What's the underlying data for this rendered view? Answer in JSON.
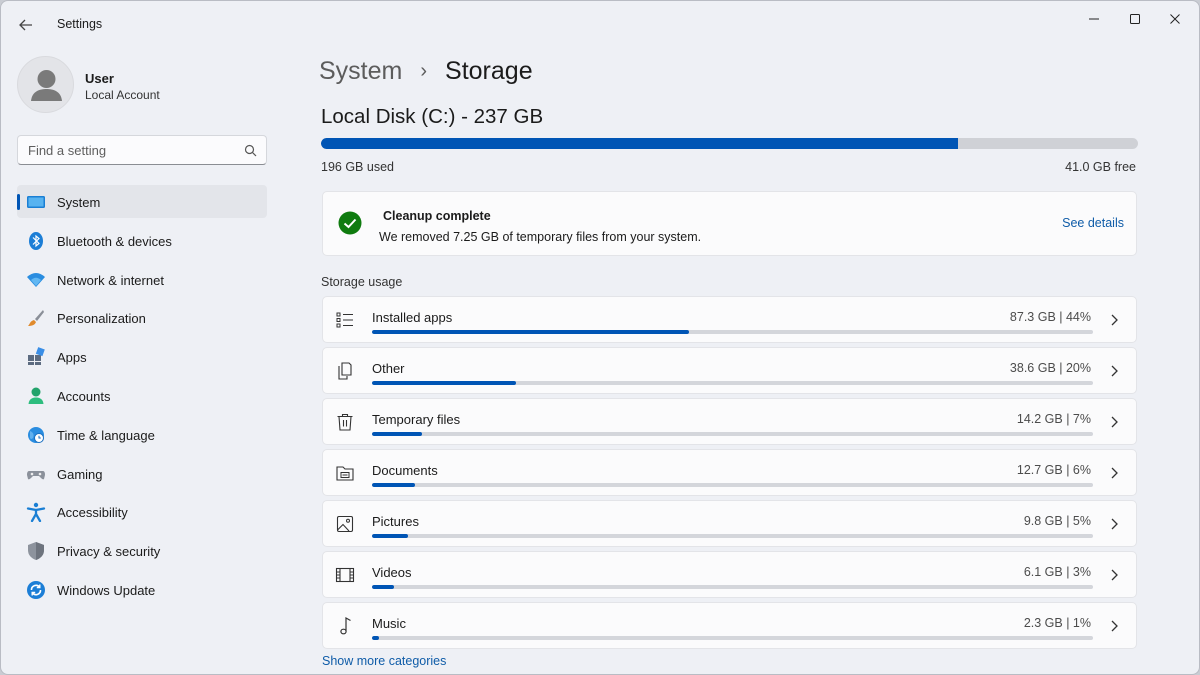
{
  "window": {
    "title": "Settings",
    "controls": [
      "minimize-icon",
      "maximize-icon",
      "close-icon"
    ]
  },
  "user": {
    "name": "User",
    "account_type": "Local Account"
  },
  "search": {
    "placeholder": "Find a setting"
  },
  "sidebar": {
    "items": [
      {
        "label": "System",
        "icon": "system-icon",
        "active": true
      },
      {
        "label": "Bluetooth & devices",
        "icon": "bluetooth-icon"
      },
      {
        "label": "Network & internet",
        "icon": "wifi-icon"
      },
      {
        "label": "Personalization",
        "icon": "brush-icon"
      },
      {
        "label": "Apps",
        "icon": "apps-icon"
      },
      {
        "label": "Accounts",
        "icon": "person-icon"
      },
      {
        "label": "Time & language",
        "icon": "globe-clock-icon"
      },
      {
        "label": "Gaming",
        "icon": "gamepad-icon"
      },
      {
        "label": "Accessibility",
        "icon": "accessibility-icon"
      },
      {
        "label": "Privacy & security",
        "icon": "shield-icon"
      },
      {
        "label": "Windows Update",
        "icon": "update-icon"
      }
    ]
  },
  "breadcrumb": {
    "parent": "System",
    "separator": "›",
    "current": "Storage"
  },
  "disk": {
    "title": "Local Disk (C:) - 237 GB",
    "used_label": "196 GB used",
    "free_label": "41.0 GB free",
    "used_fraction": 0.78
  },
  "cleanup": {
    "title": "Cleanup complete",
    "message": "We removed 7.25 GB of temporary files from your system.",
    "link": "See details"
  },
  "storage_usage": {
    "label": "Storage usage",
    "categories": [
      {
        "label": "Installed apps",
        "value": "87.3 GB  |  44%",
        "percent": 44,
        "icon": "list-icon"
      },
      {
        "label": "Other",
        "value": "38.6 GB  |  20%",
        "percent": 20,
        "icon": "copy-icon"
      },
      {
        "label": "Temporary files",
        "value": "14.2 GB  |  7%",
        "percent": 7,
        "icon": "trash-icon"
      },
      {
        "label": "Documents",
        "value": "12.7 GB  |  6%",
        "percent": 6,
        "icon": "folder-icon"
      },
      {
        "label": "Pictures",
        "value": "9.8 GB  |  5%",
        "percent": 5,
        "icon": "picture-icon"
      },
      {
        "label": "Videos",
        "value": "6.1 GB  |  3%",
        "percent": 3,
        "icon": "film-icon"
      },
      {
        "label": "Music",
        "value": "2.3 GB  |  1%",
        "percent": 1,
        "icon": "music-note-icon"
      }
    ],
    "show_more": "Show more categories"
  },
  "colors": {
    "accent": "#0055b5",
    "link": "#0f5ca8",
    "success": "#0f7b0f",
    "background": "#eef0f5",
    "card": "#fbfbfc"
  }
}
